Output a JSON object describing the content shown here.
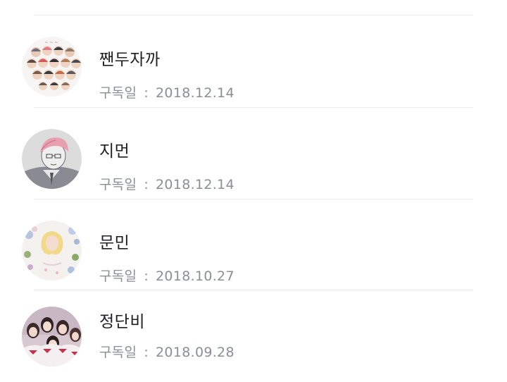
{
  "subscriptions": [
    {
      "name": "짼두자까",
      "date_label": "구독일",
      "separator": ":",
      "date": "2018.12.14",
      "avatar_icon": "illustrated-group-avatar-icon"
    },
    {
      "name": "지먼",
      "date_label": "구독일",
      "separator": ":",
      "date": "2018.12.14",
      "avatar_icon": "pink-hair-sketch-avatar-icon"
    },
    {
      "name": "문민",
      "date_label": "구독일",
      "separator": ":",
      "date": "2018.10.27",
      "avatar_icon": "floral-portrait-avatar-icon"
    },
    {
      "name": "정단비",
      "date_label": "구독일",
      "separator": ":",
      "date": "2018.09.28",
      "avatar_icon": "group-photo-avatar-icon"
    }
  ],
  "colors": {
    "name_text": "#1f1f24",
    "date_text": "#8a8e96",
    "divider": "#e9e9ec",
    "background": "#ffffff"
  }
}
